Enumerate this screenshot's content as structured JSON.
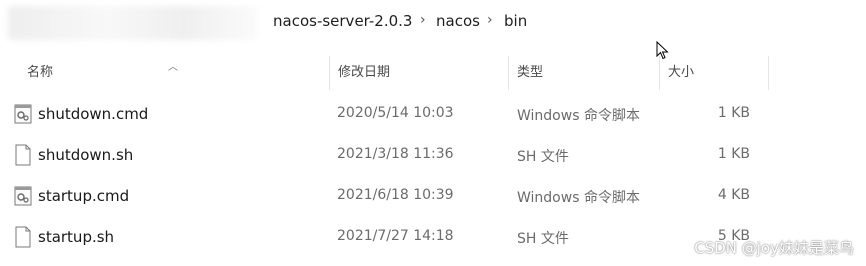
{
  "breadcrumb": {
    "items": [
      "nacos-server-2.0.3",
      "nacos",
      "bin"
    ],
    "separator": "›"
  },
  "columns": {
    "name": "名称",
    "modified": "修改日期",
    "type": "类型",
    "size": "大小"
  },
  "files": [
    {
      "name": "shutdown.cmd",
      "modified": "2020/5/14 10:03",
      "type": "Windows 命令脚本",
      "size": "1 KB",
      "icon": "cmd-script-icon"
    },
    {
      "name": "shutdown.sh",
      "modified": "2021/3/18 11:36",
      "type": "SH 文件",
      "size": "1 KB",
      "icon": "document-icon"
    },
    {
      "name": "startup.cmd",
      "modified": "2021/6/18 10:39",
      "type": "Windows 命令脚本",
      "size": "4 KB",
      "icon": "cmd-script-icon"
    },
    {
      "name": "startup.sh",
      "modified": "2021/7/27 14:18",
      "type": "SH 文件",
      "size": "5 KB",
      "icon": "document-icon"
    }
  ],
  "watermark": "CSDN @joy妹妹是菜鸟"
}
